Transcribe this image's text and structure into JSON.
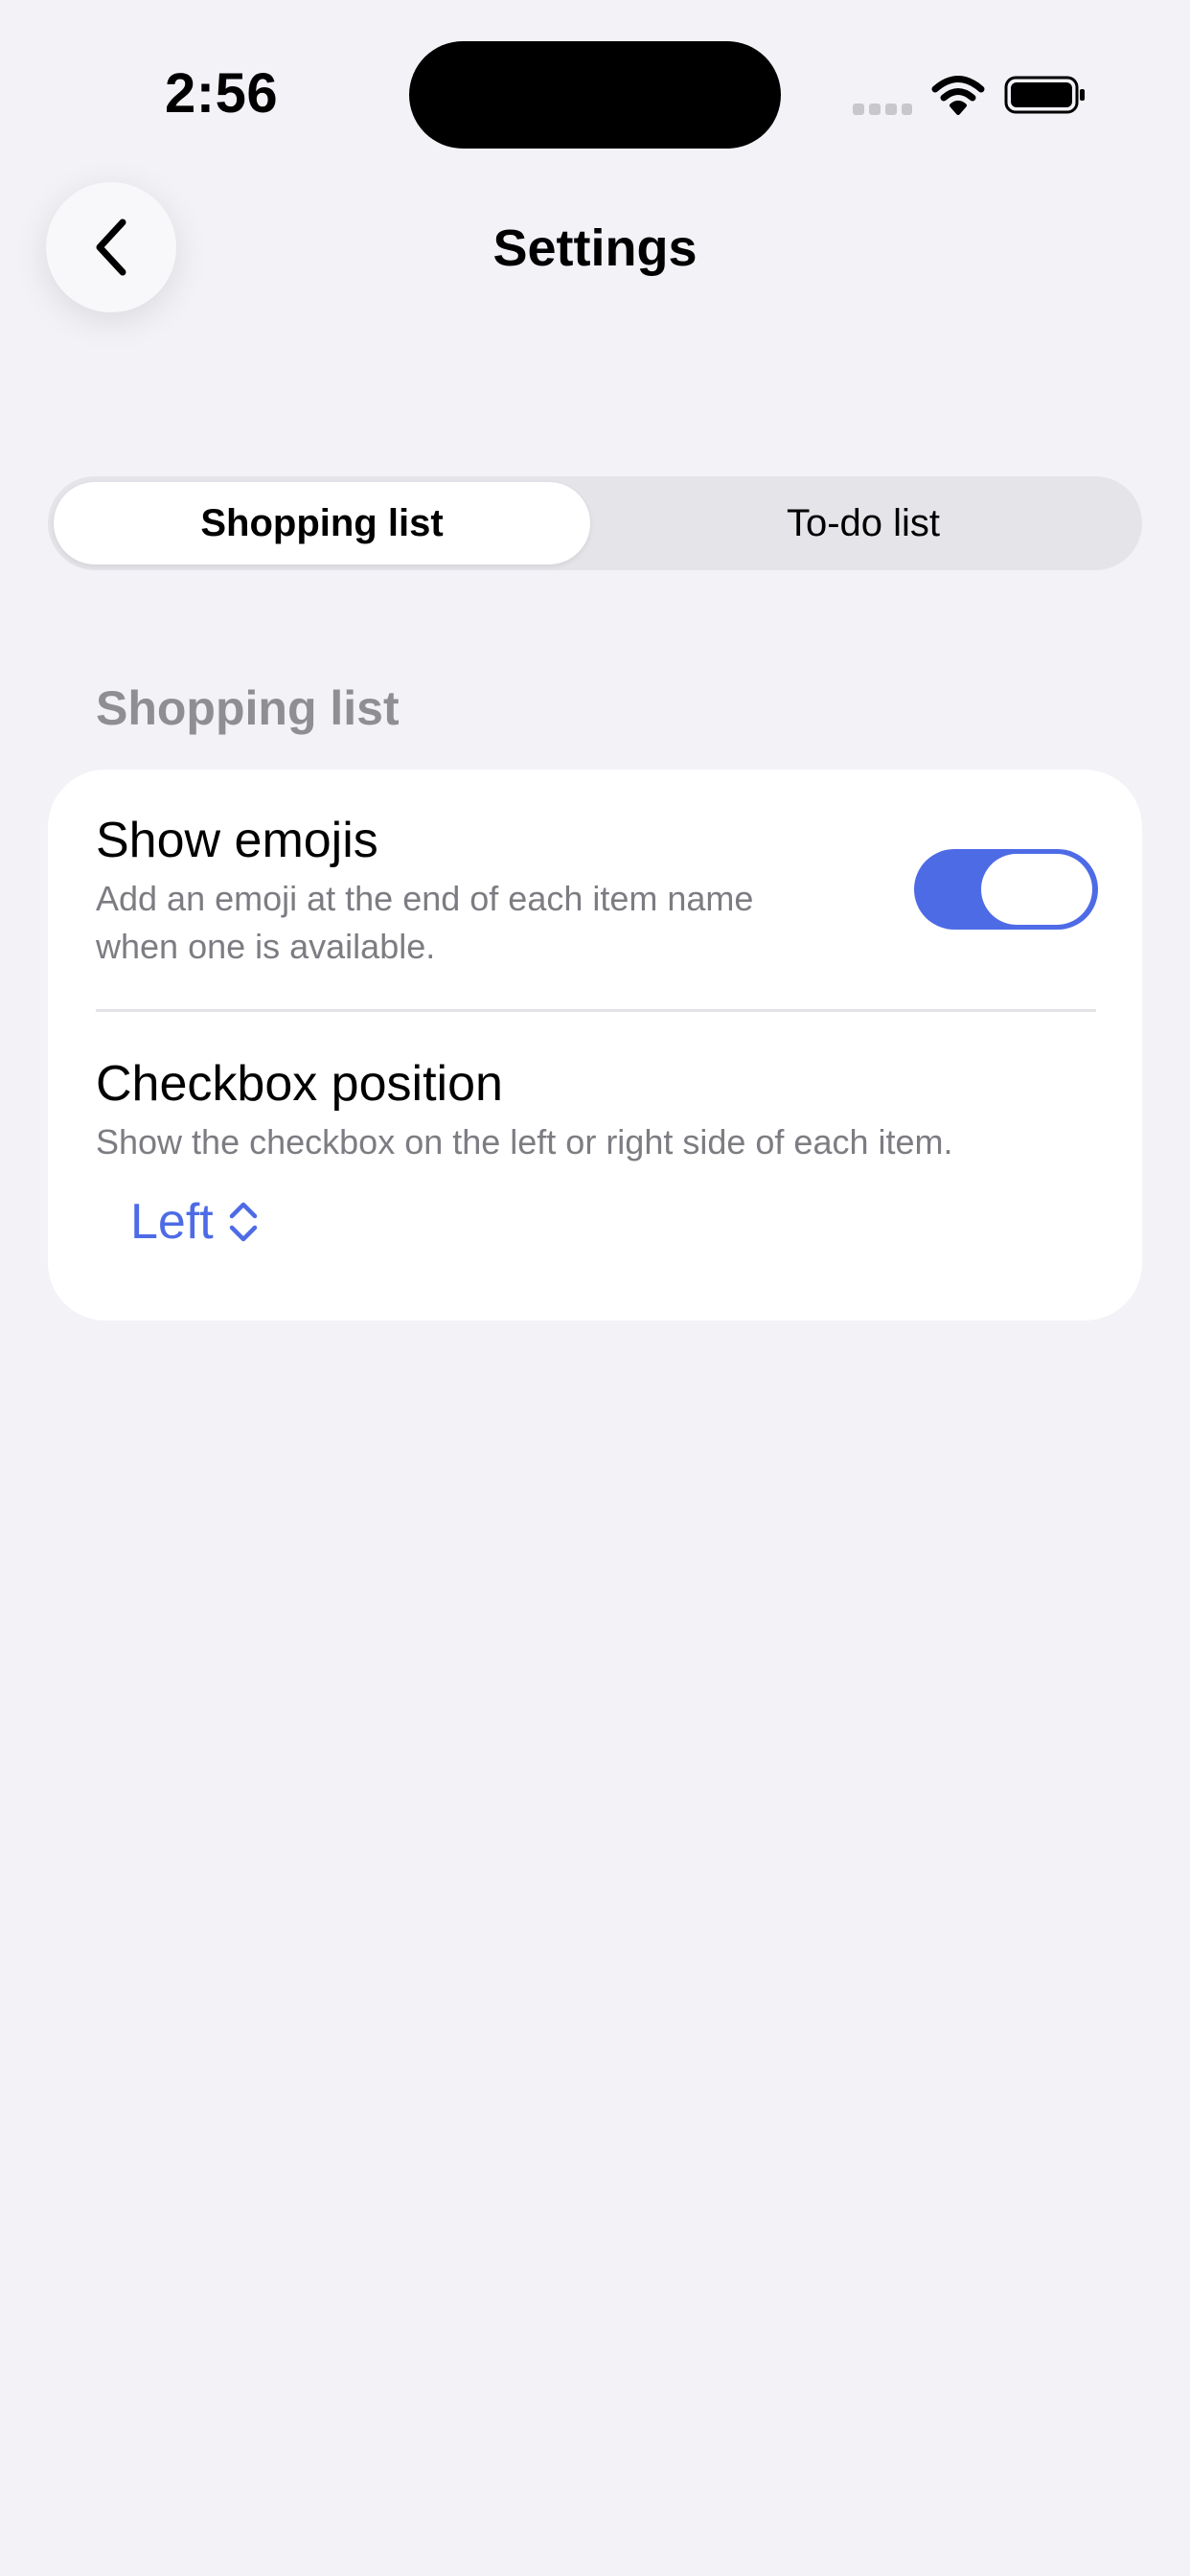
{
  "status_bar": {
    "time": "2:56"
  },
  "header": {
    "title": "Settings",
    "back_icon": "chevron-left-icon"
  },
  "tabs": [
    {
      "label": "Shopping list",
      "selected": true
    },
    {
      "label": "To-do list",
      "selected": false
    }
  ],
  "section": {
    "title": "Shopping list",
    "rows": {
      "show_emojis": {
        "title": "Show emojis",
        "description_line1": "Add an emoji at the end of each item name",
        "description_line2": "when one is available.",
        "toggle_on": true
      },
      "checkbox_position": {
        "title": "Checkbox position",
        "description": "Show the checkbox on the left or right side of each item.",
        "selected_value": "Left",
        "picker_icon": "chevron-up-down-icon"
      }
    }
  },
  "colors": {
    "background": "#F2F2F7",
    "accent": "#4E6BE6",
    "secondary_text": "#8E8E93"
  }
}
